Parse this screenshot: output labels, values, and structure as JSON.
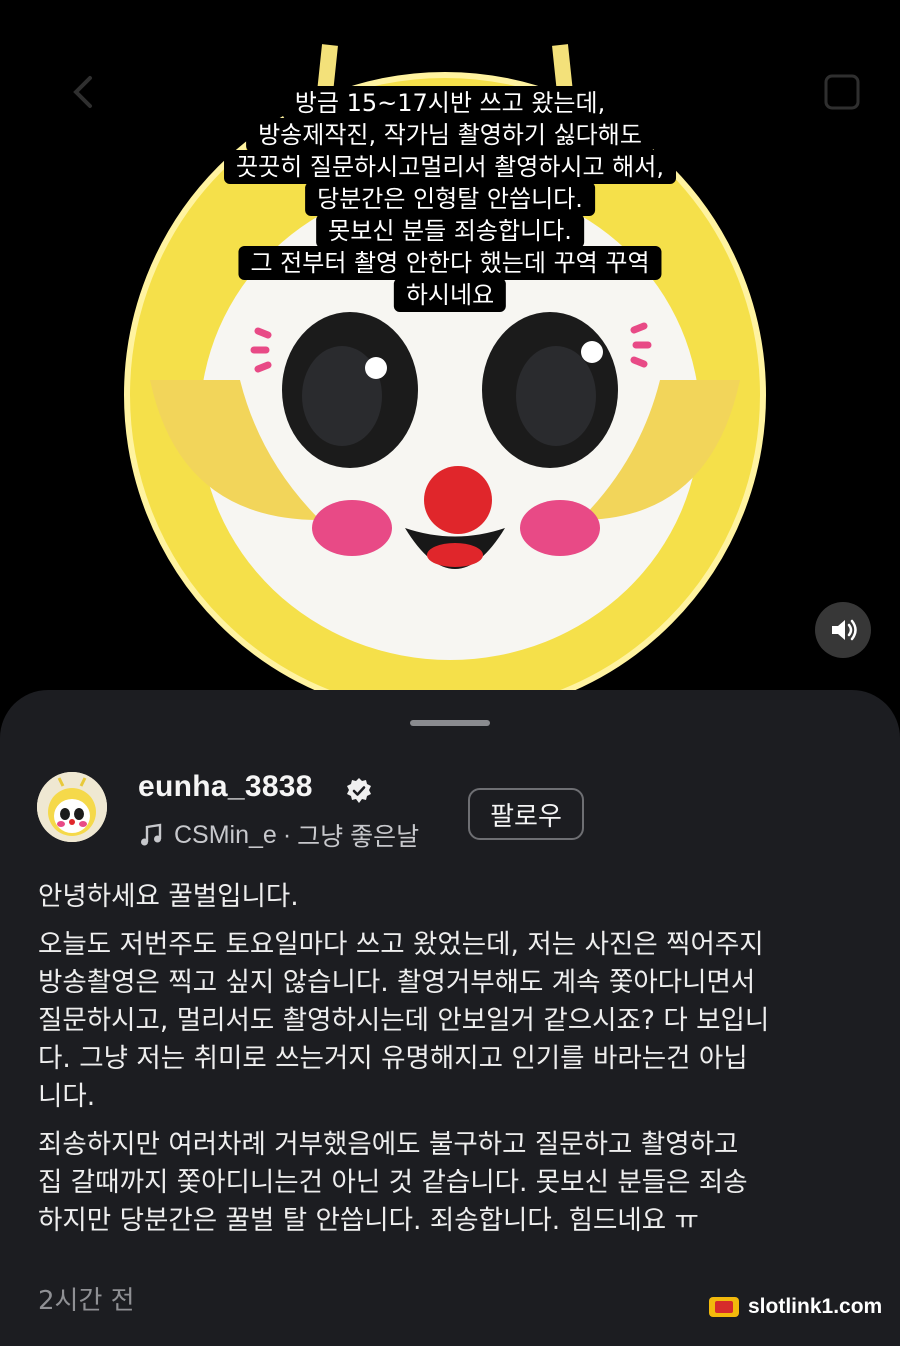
{
  "story": {
    "caption_lines": [
      "방금 15~17시반 쓰고 왔는데,",
      "방송제작진, 작가님 촬영하기 싫다해도",
      "끗끗히 질문하시고멀리서 촬영하시고 해서,",
      "당분간은 인형탈 안씁니다.",
      "못보신 분들 죄송합니다.",
      "그 전부터 촬영 안한다 했는데 꾸역 꾸역",
      "하시네요"
    ],
    "image_subject": "yellow-bee-mascot-head",
    "sound_icon": "speaker-on-icon"
  },
  "post": {
    "username": "eunha_3838",
    "verified_icon": "verified-badge-icon",
    "music": {
      "artist": "CSMin_e",
      "separator": "·",
      "song": "그냥 좋은날"
    },
    "follow_label": "팔로우",
    "paragraphs": [
      "안녕하세요 꿀벌입니다.",
      "오늘도 저번주도 토요일마다 쓰고 왔었는데, 저는 사진은 찍어주지\n방송촬영은 찍고 싶지 않습니다. 촬영거부해도 계속 쫓아다니면서\n질문하시고, 멀리서도 촬영하시는데 안보일거 같으시죠? 다 보입니\n다. 그냥 저는 취미로 쓰는거지 유명해지고 인기를 바라는건 아닙\n니다.",
      "죄송하지만 여러차례 거부했음에도 불구하고 질문하고 촬영하고\n집 갈때까지 쫓아디니는건 아닌 것 같습니다.  못보신 분들은 죄송\n하지만 당분간은 꿀벌 탈 안씁니다. 죄송합니다. 힘드네요 ㅠ"
    ],
    "timestamp": "2시간 전"
  },
  "watermark": {
    "text": "slotlink1.com"
  },
  "colors": {
    "background": "#000000",
    "sheet": "#1c1d21",
    "mascot_yellow": "#f5e04a",
    "cheek_pink": "#e84a86",
    "nose_red": "#e0262b"
  }
}
